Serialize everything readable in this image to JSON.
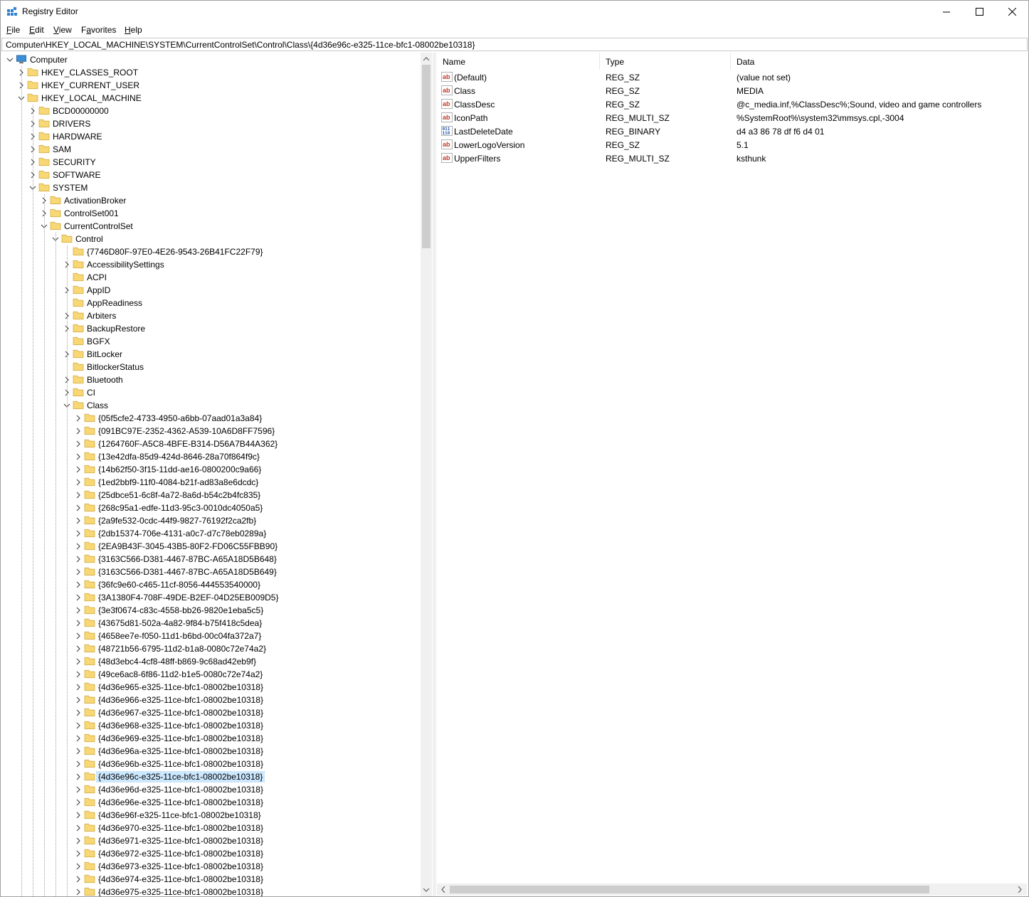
{
  "window": {
    "title": "Registry Editor",
    "controls": {
      "minimize": "minimize",
      "maximize": "maximize",
      "close": "close"
    }
  },
  "menu": {
    "items": [
      {
        "label": "File",
        "u": "F",
        "rest": "ile"
      },
      {
        "label": "Edit",
        "u": "E",
        "rest": "dit"
      },
      {
        "label": "View",
        "u": "V",
        "rest": "iew"
      },
      {
        "label": "Favorites",
        "u": "",
        "pre": "F",
        "u2": "a",
        "rest": "vorites"
      },
      {
        "label": "Help",
        "u": "H",
        "rest": "elp"
      }
    ]
  },
  "address": "Computer\\HKEY_LOCAL_MACHINE\\SYSTEM\\CurrentControlSet\\Control\\Class\\{4d36e96c-e325-11ce-bfc1-08002be10318}",
  "tree": [
    {
      "label": "Computer",
      "depth": 0,
      "expander": "open",
      "icon": "computer-icon"
    },
    {
      "label": "HKEY_CLASSES_ROOT",
      "depth": 1,
      "expander": "closed"
    },
    {
      "label": "HKEY_CURRENT_USER",
      "depth": 1,
      "expander": "closed"
    },
    {
      "label": "HKEY_LOCAL_MACHINE",
      "depth": 1,
      "expander": "open"
    },
    {
      "label": "BCD00000000",
      "depth": 2,
      "expander": "closed"
    },
    {
      "label": "DRIVERS",
      "depth": 2,
      "expander": "closed"
    },
    {
      "label": "HARDWARE",
      "depth": 2,
      "expander": "closed"
    },
    {
      "label": "SAM",
      "depth": 2,
      "expander": "closed"
    },
    {
      "label": "SECURITY",
      "depth": 2,
      "expander": "closed"
    },
    {
      "label": "SOFTWARE",
      "depth": 2,
      "expander": "closed"
    },
    {
      "label": "SYSTEM",
      "depth": 2,
      "expander": "open"
    },
    {
      "label": "ActivationBroker",
      "depth": 3,
      "expander": "closed"
    },
    {
      "label": "ControlSet001",
      "depth": 3,
      "expander": "closed"
    },
    {
      "label": "CurrentControlSet",
      "depth": 3,
      "expander": "open"
    },
    {
      "label": "Control",
      "depth": 4,
      "expander": "open"
    },
    {
      "label": "{7746D80F-97E0-4E26-9543-26B41FC22F79}",
      "depth": 5,
      "expander": "none"
    },
    {
      "label": "AccessibilitySettings",
      "depth": 5,
      "expander": "closed"
    },
    {
      "label": "ACPI",
      "depth": 5,
      "expander": "none"
    },
    {
      "label": "AppID",
      "depth": 5,
      "expander": "closed"
    },
    {
      "label": "AppReadiness",
      "depth": 5,
      "expander": "none"
    },
    {
      "label": "Arbiters",
      "depth": 5,
      "expander": "closed"
    },
    {
      "label": "BackupRestore",
      "depth": 5,
      "expander": "closed"
    },
    {
      "label": "BGFX",
      "depth": 5,
      "expander": "none"
    },
    {
      "label": "BitLocker",
      "depth": 5,
      "expander": "closed"
    },
    {
      "label": "BitlockerStatus",
      "depth": 5,
      "expander": "none"
    },
    {
      "label": "Bluetooth",
      "depth": 5,
      "expander": "closed"
    },
    {
      "label": "CI",
      "depth": 5,
      "expander": "closed"
    },
    {
      "label": "Class",
      "depth": 5,
      "expander": "open"
    },
    {
      "label": "{05f5cfe2-4733-4950-a6bb-07aad01a3a84}",
      "depth": 6,
      "expander": "closed"
    },
    {
      "label": "{091BC97E-2352-4362-A539-10A6D8FF7596}",
      "depth": 6,
      "expander": "closed"
    },
    {
      "label": "{1264760F-A5C8-4BFE-B314-D56A7B44A362}",
      "depth": 6,
      "expander": "closed"
    },
    {
      "label": "{13e42dfa-85d9-424d-8646-28a70f864f9c}",
      "depth": 6,
      "expander": "closed"
    },
    {
      "label": "{14b62f50-3f15-11dd-ae16-0800200c9a66}",
      "depth": 6,
      "expander": "closed"
    },
    {
      "label": "{1ed2bbf9-11f0-4084-b21f-ad83a8e6dcdc}",
      "depth": 6,
      "expander": "closed"
    },
    {
      "label": "{25dbce51-6c8f-4a72-8a6d-b54c2b4fc835}",
      "depth": 6,
      "expander": "closed"
    },
    {
      "label": "{268c95a1-edfe-11d3-95c3-0010dc4050a5}",
      "depth": 6,
      "expander": "closed"
    },
    {
      "label": "{2a9fe532-0cdc-44f9-9827-76192f2ca2fb}",
      "depth": 6,
      "expander": "closed"
    },
    {
      "label": "{2db15374-706e-4131-a0c7-d7c78eb0289a}",
      "depth": 6,
      "expander": "closed"
    },
    {
      "label": "{2EA9B43F-3045-43B5-80F2-FD06C55FBB90}",
      "depth": 6,
      "expander": "closed"
    },
    {
      "label": "{3163C566-D381-4467-87BC-A65A18D5B648}",
      "depth": 6,
      "expander": "closed"
    },
    {
      "label": "{3163C566-D381-4467-87BC-A65A18D5B649}",
      "depth": 6,
      "expander": "closed"
    },
    {
      "label": "{36fc9e60-c465-11cf-8056-444553540000}",
      "depth": 6,
      "expander": "closed"
    },
    {
      "label": "{3A1380F4-708F-49DE-B2EF-04D25EB009D5}",
      "depth": 6,
      "expander": "closed"
    },
    {
      "label": "{3e3f0674-c83c-4558-bb26-9820e1eba5c5}",
      "depth": 6,
      "expander": "closed"
    },
    {
      "label": "{43675d81-502a-4a82-9f84-b75f418c5dea}",
      "depth": 6,
      "expander": "closed"
    },
    {
      "label": "{4658ee7e-f050-11d1-b6bd-00c04fa372a7}",
      "depth": 6,
      "expander": "closed"
    },
    {
      "label": "{48721b56-6795-11d2-b1a8-0080c72e74a2}",
      "depth": 6,
      "expander": "closed"
    },
    {
      "label": "{48d3ebc4-4cf8-48ff-b869-9c68ad42eb9f}",
      "depth": 6,
      "expander": "closed"
    },
    {
      "label": "{49ce6ac8-6f86-11d2-b1e5-0080c72e74a2}",
      "depth": 6,
      "expander": "closed"
    },
    {
      "label": "{4d36e965-e325-11ce-bfc1-08002be10318}",
      "depth": 6,
      "expander": "closed"
    },
    {
      "label": "{4d36e966-e325-11ce-bfc1-08002be10318}",
      "depth": 6,
      "expander": "closed"
    },
    {
      "label": "{4d36e967-e325-11ce-bfc1-08002be10318}",
      "depth": 6,
      "expander": "closed"
    },
    {
      "label": "{4d36e968-e325-11ce-bfc1-08002be10318}",
      "depth": 6,
      "expander": "closed"
    },
    {
      "label": "{4d36e969-e325-11ce-bfc1-08002be10318}",
      "depth": 6,
      "expander": "closed"
    },
    {
      "label": "{4d36e96a-e325-11ce-bfc1-08002be10318}",
      "depth": 6,
      "expander": "closed"
    },
    {
      "label": "{4d36e96b-e325-11ce-bfc1-08002be10318}",
      "depth": 6,
      "expander": "closed"
    },
    {
      "label": "{4d36e96c-e325-11ce-bfc1-08002be10318}",
      "depth": 6,
      "expander": "closed",
      "selected": true
    },
    {
      "label": "{4d36e96d-e325-11ce-bfc1-08002be10318}",
      "depth": 6,
      "expander": "closed"
    },
    {
      "label": "{4d36e96e-e325-11ce-bfc1-08002be10318}",
      "depth": 6,
      "expander": "closed"
    },
    {
      "label": "{4d36e96f-e325-11ce-bfc1-08002be10318}",
      "depth": 6,
      "expander": "closed"
    },
    {
      "label": "{4d36e970-e325-11ce-bfc1-08002be10318}",
      "depth": 6,
      "expander": "closed"
    },
    {
      "label": "{4d36e971-e325-11ce-bfc1-08002be10318}",
      "depth": 6,
      "expander": "closed"
    },
    {
      "label": "{4d36e972-e325-11ce-bfc1-08002be10318}",
      "depth": 6,
      "expander": "closed"
    },
    {
      "label": "{4d36e973-e325-11ce-bfc1-08002be10318}",
      "depth": 6,
      "expander": "closed"
    },
    {
      "label": "{4d36e974-e325-11ce-bfc1-08002be10318}",
      "depth": 6,
      "expander": "closed"
    },
    {
      "label": "{4d36e975-e325-11ce-bfc1-08002be10318}",
      "depth": 6,
      "expander": "closed"
    }
  ],
  "list": {
    "columns": [
      "Name",
      "Type",
      "Data"
    ],
    "rows": [
      {
        "icon": "string-value-icon",
        "name": "(Default)",
        "type": "REG_SZ",
        "data": "(value not set)"
      },
      {
        "icon": "string-value-icon",
        "name": "Class",
        "type": "REG_SZ",
        "data": "MEDIA"
      },
      {
        "icon": "string-value-icon",
        "name": "ClassDesc",
        "type": "REG_SZ",
        "data": "@c_media.inf,%ClassDesc%;Sound, video and game controllers"
      },
      {
        "icon": "string-value-icon",
        "name": "IconPath",
        "type": "REG_MULTI_SZ",
        "data": "%SystemRoot%\\system32\\mmsys.cpl,-3004"
      },
      {
        "icon": "binary-value-icon",
        "name": "LastDeleteDate",
        "type": "REG_BINARY",
        "data": "d4 a3 86 78 df f6 d4 01"
      },
      {
        "icon": "string-value-icon",
        "name": "LowerLogoVersion",
        "type": "REG_SZ",
        "data": "5.1"
      },
      {
        "icon": "string-value-icon",
        "name": "UpperFilters",
        "type": "REG_MULTI_SZ",
        "data": "ksthunk"
      }
    ]
  },
  "colors": {
    "folder": "#f8d775",
    "selection": "#cce8ff",
    "string_icon": "#c0392b",
    "binary_icon": "#1e4fa3"
  }
}
